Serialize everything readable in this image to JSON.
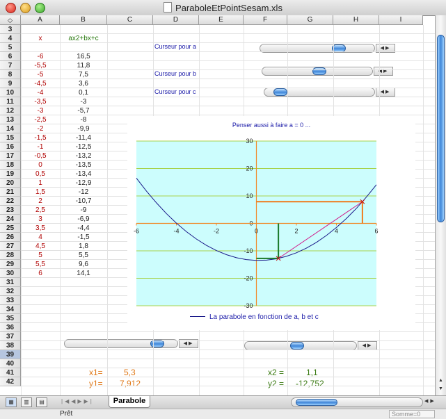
{
  "window": {
    "title": "ParaboleEtPointSesam.xls"
  },
  "columns": [
    "A",
    "B",
    "C",
    "D",
    "E",
    "F",
    "G",
    "H",
    "I"
  ],
  "corner_glyph": "◇",
  "row_numbers": [
    3,
    4,
    5,
    6,
    7,
    8,
    9,
    10,
    11,
    12,
    13,
    14,
    15,
    16,
    17,
    18,
    19,
    20,
    21,
    22,
    23,
    24,
    25,
    26,
    27,
    28,
    29,
    30,
    31,
    32,
    33,
    34,
    35,
    36,
    37,
    38,
    39,
    40,
    41,
    42
  ],
  "selected_row": 39,
  "table": {
    "header_x": "x",
    "header_fx": "ax2+bx+c",
    "rows": [
      {
        "x": "-6",
        "y": "16,5"
      },
      {
        "x": "-5,5",
        "y": "11,8"
      },
      {
        "x": "-5",
        "y": "7,5"
      },
      {
        "x": "-4,5",
        "y": "3,6"
      },
      {
        "x": "-4",
        "y": "0,1"
      },
      {
        "x": "-3,5",
        "y": "-3"
      },
      {
        "x": "-3",
        "y": "-5,7"
      },
      {
        "x": "-2,5",
        "y": "-8"
      },
      {
        "x": "-2",
        "y": "-9,9"
      },
      {
        "x": "-1,5",
        "y": "-11,4"
      },
      {
        "x": "-1",
        "y": "-12,5"
      },
      {
        "x": "-0,5",
        "y": "-13,2"
      },
      {
        "x": "0",
        "y": "-13,5"
      },
      {
        "x": "0,5",
        "y": "-13,4"
      },
      {
        "x": "1",
        "y": "-12,9"
      },
      {
        "x": "1,5",
        "y": "-12"
      },
      {
        "x": "2",
        "y": "-10,7"
      },
      {
        "x": "2,5",
        "y": "-9"
      },
      {
        "x": "3",
        "y": "-6,9"
      },
      {
        "x": "3,5",
        "y": "-4,4"
      },
      {
        "x": "4",
        "y": "-1,5"
      },
      {
        "x": "4,5",
        "y": "1,8"
      },
      {
        "x": "5",
        "y": "5,5"
      },
      {
        "x": "5,5",
        "y": "9,6"
      },
      {
        "x": "6",
        "y": "14,1"
      }
    ]
  },
  "sliders": {
    "a": {
      "label": "Curseur pour a",
      "position_fraction": 0.72
    },
    "b": {
      "label": "Curseur pour b",
      "position_fraction": 0.52
    },
    "c": {
      "label": "Curseur pour c",
      "position_fraction": 0.08
    },
    "point1": {
      "position_fraction": 0.88
    },
    "point2": {
      "position_fraction": 0.46
    }
  },
  "results": {
    "x1_label": "x1=",
    "x1_value": "5,3",
    "y1_label": "y1=",
    "y1_value": "7,912",
    "x2_label": "x2 =",
    "x2_value": "1,1",
    "y2_label": "y2 =",
    "y2_value": "-12,752"
  },
  "chart_data": {
    "type": "line",
    "title": "Penser aussi à faire a = 0 ...",
    "xlim": [
      -6,
      6
    ],
    "ylim": [
      -30,
      30
    ],
    "x_ticks": [
      -6,
      -4,
      -2,
      0,
      2,
      4,
      6
    ],
    "y_ticks": [
      -30,
      -20,
      -10,
      0,
      10,
      20,
      30
    ],
    "legend": "La parabole en fonction de a, b et c",
    "series": [
      {
        "name": "La parabole en fonction de a, b et c",
        "x": [
          -6,
          -5.5,
          -5,
          -4.5,
          -4,
          -3.5,
          -3,
          -2.5,
          -2,
          -1.5,
          -1,
          -0.5,
          0,
          0.5,
          1,
          1.5,
          2,
          2.5,
          3,
          3.5,
          4,
          4.5,
          5,
          5.5,
          6
        ],
        "y": [
          16.5,
          11.8,
          7.5,
          3.6,
          0.1,
          -3,
          -5.7,
          -8,
          -9.9,
          -11.4,
          -12.5,
          -13.2,
          -13.5,
          -13.4,
          -12.9,
          -12,
          -10.7,
          -9,
          -6.9,
          -4.4,
          -1.5,
          1.8,
          5.5,
          9.6,
          14.1
        ]
      }
    ],
    "points": [
      {
        "name": "point1",
        "x": 5.3,
        "y": 7.912,
        "color": "#f07a1a"
      },
      {
        "name": "point2",
        "x": 1.1,
        "y": -12.752,
        "color": "#1a7a2a"
      }
    ],
    "colors": {
      "curve": "#1a1a8a",
      "grid": "#a8d24a",
      "axis": "#f08a2a",
      "segment": "#d01a8a",
      "point1": "#f07a1a",
      "point2": "#1a7a2a"
    },
    "background": "#ccfdfd"
  },
  "sheet_tab": "Parabole",
  "status": {
    "text": "Prêt",
    "sum": "Somme=0"
  }
}
